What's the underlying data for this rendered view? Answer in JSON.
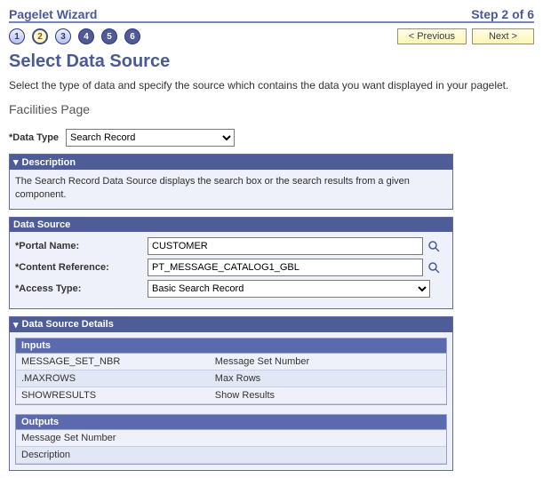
{
  "header": {
    "wizard_title": "Pagelet Wizard",
    "step_text": "Step 2 of 6",
    "steps": [
      "1",
      "2",
      "3",
      "4",
      "5",
      "6"
    ],
    "active_step_index": 1,
    "prev_label": "< Previous",
    "next_label": "Next >"
  },
  "page": {
    "title": "Select Data Source",
    "intro": "Select the type of data and specify the source which contains the data you want displayed in your pagelet.",
    "subhead": "Facilities Page"
  },
  "data_type": {
    "label": "*Data Type",
    "value": "Search Record"
  },
  "description_section": {
    "title": "Description",
    "text": "The Search Record Data Source displays the search box or the search results from a given component."
  },
  "data_source_section": {
    "title": "Data Source",
    "portal_name_label": "*Portal Name:",
    "portal_name_value": "CUSTOMER",
    "content_ref_label": "*Content Reference:",
    "content_ref_value": "PT_MESSAGE_CATALOG1_GBL",
    "access_type_label": "*Access Type:",
    "access_type_value": "Basic Search Record"
  },
  "details_section": {
    "title": "Data Source Details",
    "inputs_header": "Inputs",
    "outputs_header": "Outputs",
    "inputs": [
      {
        "name": "MESSAGE_SET_NBR",
        "desc": "Message Set Number"
      },
      {
        "name": ".MAXROWS",
        "desc": "Max Rows"
      },
      {
        "name": "SHOWRESULTS",
        "desc": "Show Results"
      }
    ],
    "outputs": [
      {
        "desc": "Message Set Number"
      },
      {
        "desc": "Description"
      }
    ]
  },
  "icons": {
    "collapse_triangle": "▾"
  }
}
